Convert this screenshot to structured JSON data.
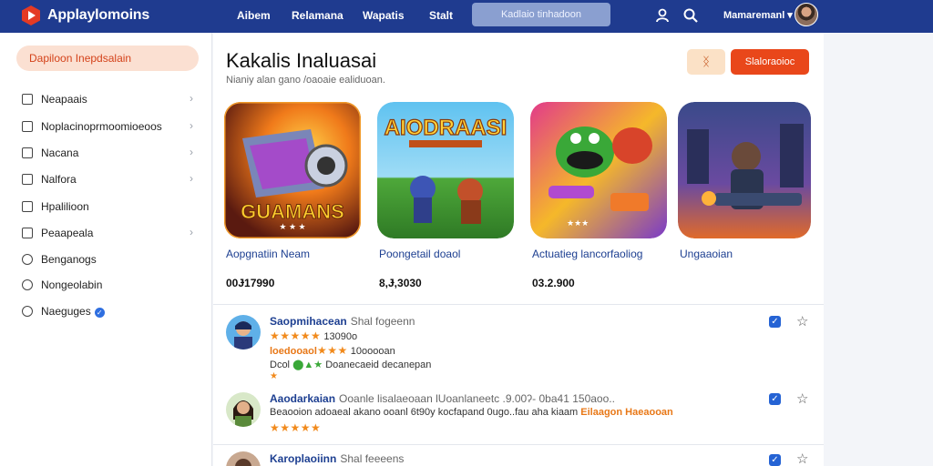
{
  "header": {
    "brand": "Applaylomoins",
    "nav": [
      "Aibem",
      "Relamana",
      "Wapatis",
      "Stalt"
    ],
    "search_placeholder": "Kadlaio tinhadoon",
    "user_name": "Mamaremanl ▾",
    "accent": "#1f3b8f"
  },
  "sidebar": {
    "highlight": "Dapiloon Inepdsalain",
    "items": [
      {
        "label": "Neapaais",
        "chevron": true,
        "icon": "square-icon"
      },
      {
        "label": "Noplacinoprmoomioeoos",
        "chevron": true,
        "icon": "square-icon"
      },
      {
        "label": "Nacana",
        "chevron": true,
        "icon": "square-icon"
      },
      {
        "label": "Nalfora",
        "chevron": true,
        "icon": "square-icon"
      },
      {
        "label": "Hpalilioon",
        "chevron": false,
        "icon": "square-icon"
      },
      {
        "label": "Peaapeala",
        "chevron": true,
        "icon": "square-icon"
      },
      {
        "label": "Benganogs",
        "chevron": false,
        "icon": "circle-icon"
      },
      {
        "label": "Nongeolabin",
        "chevron": false,
        "icon": "circle-icon"
      },
      {
        "label": "Naeguges",
        "chevron": false,
        "icon": "circle-icon",
        "verified": true
      }
    ]
  },
  "main": {
    "title": "Kakalis Inaluasai",
    "subtitle": "Nianiy alan gano /oaoaie ealiduoan.",
    "btn_ghost": "ᛝ",
    "btn_primary": "Slaloraoioc",
    "cards": [
      {
        "title": "Aopgnatiin Neam",
        "price": "00Ɉ17990",
        "art_title": "GUAMANS"
      },
      {
        "title": "Poongetail doaol",
        "price": "8,Ɉ,3030",
        "art_title": "AIODRAASI"
      },
      {
        "title": "Actuatieg lancorfaoliog",
        "price": "03.2.900",
        "art_title": ""
      },
      {
        "title": "Ungaaoian",
        "price": "",
        "art_title": ""
      }
    ],
    "reviews": [
      {
        "name": "Saopmihacean",
        "meta": "Shal fogeenn",
        "line1_stars": "★★★★★",
        "line1_text": "13090o",
        "line2_label": "loedooaol",
        "line2_stars": "★★★",
        "line2_text": "10ooooan",
        "line3_prefix": "Dcol",
        "line3_icons": "⬤▲★",
        "line3_text": "Doanecaeid decanepan",
        "line4": "★"
      },
      {
        "name": "Aaodarkaian",
        "meta": "Ooanle lisalaeoaan lUoanlaneetc .9.00ʔ- 0ba41 150aoo..",
        "line1_text": "Beaooion adoaeal akano ooanl 6t90y kocfapand 0ugo..fau aha kiaam",
        "line1_highlight": "Eilaagon Haeaooan",
        "line2_stars": "★★★★★"
      },
      {
        "name": "Karoplaoiinn",
        "meta": "Shal feeeens"
      }
    ]
  }
}
